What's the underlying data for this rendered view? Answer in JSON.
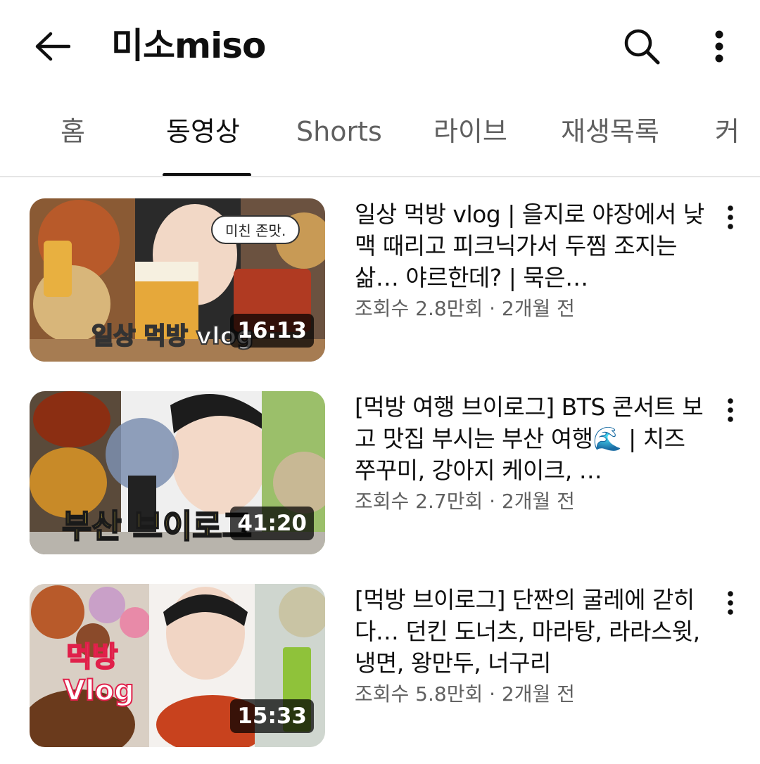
{
  "header": {
    "back_icon": "arrow-left-icon",
    "channel_name": "미소miso",
    "search_icon": "search-icon",
    "more_icon": "more-vertical-icon"
  },
  "tabs": [
    {
      "label": "홈",
      "active": false
    },
    {
      "label": "동영상",
      "active": true
    },
    {
      "label": "Shorts",
      "active": false
    },
    {
      "label": "라이브",
      "active": false
    },
    {
      "label": "재생목록",
      "active": false
    },
    {
      "label": "커",
      "active": false
    }
  ],
  "videos": [
    {
      "title": "일상 먹방 vlog | 을지로 야장에서 낮맥 때리고 피크닉가서 두찜 조지는 삶… 야르한데? | 묵은…",
      "meta": "조회수 2.8만회 · 2개월 전",
      "duration": "16:13",
      "thumb_text": "일상 먹방 vlog",
      "bubble": "미친 존맛."
    },
    {
      "title": "[먹방 여행 브이로그] BTS 콘서트 보고 맛집 부시는 부산 여행🌊 | 치즈 쭈꾸미, 강아지 케이크, …",
      "meta": "조회수 2.7만회 · 2개월 전",
      "duration": "41:20",
      "thumb_text": "부산 브이로그"
    },
    {
      "title": "[먹방 브이로그] 단짠의 굴레에 갇히다… 던킨 도너츠, 마라탕, 라라스윗, 냉면, 왕만두, 너구리",
      "meta": "조회수 5.8만회 · 2개월 전",
      "duration": "15:33",
      "thumb_text_line1": "먹방",
      "thumb_text_line2": "Vlog"
    }
  ],
  "colors": {
    "text_primary": "#0f0f0f",
    "text_secondary": "#606060",
    "divider": "#e5e5e5"
  }
}
